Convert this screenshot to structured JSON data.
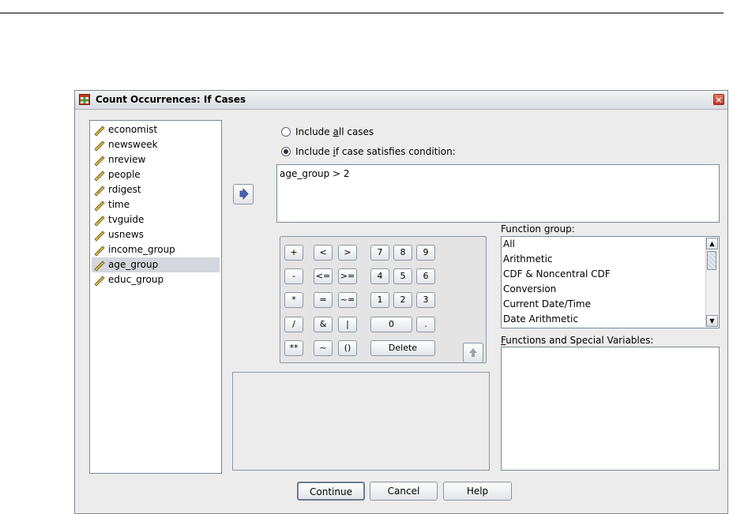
{
  "dialog": {
    "title": "Count Occurrences: If Cases",
    "close_symbol": "×"
  },
  "variables": [
    {
      "label": "economist",
      "selected": false
    },
    {
      "label": "newsweek",
      "selected": false
    },
    {
      "label": "nreview",
      "selected": false
    },
    {
      "label": "people",
      "selected": false
    },
    {
      "label": "rdigest",
      "selected": false
    },
    {
      "label": "time",
      "selected": false
    },
    {
      "label": "tvguide",
      "selected": false
    },
    {
      "label": "usnews",
      "selected": false
    },
    {
      "label": "income_group",
      "selected": false
    },
    {
      "label": "age_group",
      "selected": true
    },
    {
      "label": "educ_group",
      "selected": false
    }
  ],
  "radios": {
    "all_pre": "Include ",
    "all_key": "a",
    "all_post": "ll cases",
    "all_selected": false,
    "if_pre": "Include ",
    "if_key": "i",
    "if_post": "f case satisfies condition:",
    "if_selected": true
  },
  "condition": "age_group > 2",
  "keypad": {
    "plus": "+",
    "lt": "<",
    "gt": ">",
    "k7": "7",
    "k8": "8",
    "k9": "9",
    "minus": "-",
    "le": "<=",
    "ge": ">=",
    "k4": "4",
    "k5": "5",
    "k6": "6",
    "mult": "*",
    "eq": "=",
    "ne": "~=",
    "k1": "1",
    "k2": "2",
    "k3": "3",
    "div": "/",
    "and": "&",
    "or": "|",
    "k0": "0",
    "dot": ".",
    "pow": "**",
    "not": "~",
    "paren": "()",
    "delete": "Delete"
  },
  "function_group": {
    "label_pre": "Function ",
    "label_key": "g",
    "label_post": "roup:",
    "items": [
      "All",
      "Arithmetic",
      "CDF & Noncentral CDF",
      "Conversion",
      "Current Date/Time",
      "Date Arithmetic"
    ]
  },
  "functions_special": {
    "label_key": "F",
    "label_post": "unctions and Special Variables:"
  },
  "buttons": {
    "continue": "Continue",
    "cancel": "Cancel",
    "help": "Help"
  },
  "icons": {
    "move_right": "arrow-right-icon",
    "move_up": "arrow-up-icon",
    "variable": "ruler-scale-icon"
  },
  "colors": {
    "accent": "#4b5fb5",
    "selection": "#d4d6dd"
  }
}
